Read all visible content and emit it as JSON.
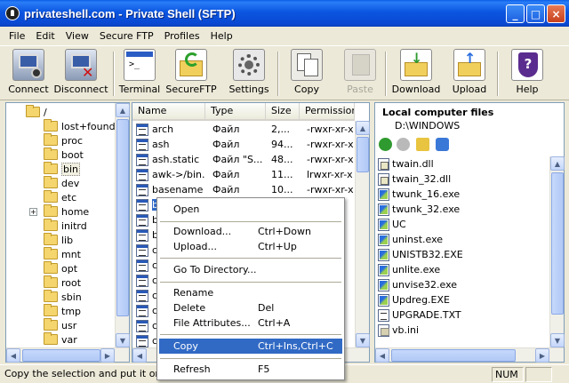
{
  "window": {
    "title": "privateshell.com - Private Shell (SFTP)",
    "min": "_",
    "max": "□",
    "close": "×"
  },
  "menu": [
    "File",
    "Edit",
    "View",
    "Secure FTP",
    "Profiles",
    "Help"
  ],
  "toolbar": {
    "connect": "Connect",
    "disconnect": "Disconnect",
    "terminal": "Terminal",
    "secureftp": "SecureFTP",
    "settings": "Settings",
    "copy": "Copy",
    "paste": "Paste",
    "download": "Download",
    "upload": "Upload",
    "help": "Help"
  },
  "tree": {
    "root": "/",
    "folders": [
      "lost+found",
      "proc",
      "boot",
      "bin",
      "dev",
      "etc",
      "home",
      "initrd",
      "lib",
      "mnt",
      "opt",
      "root",
      "sbin",
      "tmp",
      "usr",
      "var"
    ],
    "selected": "bin",
    "expander": "+"
  },
  "files": {
    "columns": [
      "Name",
      "Type",
      "Size",
      "Permissions"
    ],
    "rows": [
      {
        "name": "arch",
        "type": "Файл",
        "size": "2,...",
        "perm": "-rwxr-xr-x"
      },
      {
        "name": "ash",
        "type": "Файл",
        "size": "94...",
        "perm": "-rwxr-xr-x"
      },
      {
        "name": "ash.static",
        "type": "Файл \"S...",
        "size": "48...",
        "perm": "-rwxr-xr-x"
      },
      {
        "name": "awk->/bin...",
        "type": "Файл",
        "size": "11...",
        "perm": "lrwxr-xr-x"
      },
      {
        "name": "basename",
        "type": "Файл",
        "size": "10...",
        "perm": "-rwxr-xr-x"
      },
      {
        "name": "b",
        "type": "",
        "size": "",
        "perm": ""
      },
      {
        "name": "b",
        "type": "",
        "size": "",
        "perm": ""
      },
      {
        "name": "b",
        "type": "",
        "size": "",
        "perm": ""
      },
      {
        "name": "c",
        "type": "",
        "size": "",
        "perm": ""
      },
      {
        "name": "c",
        "type": "",
        "size": "",
        "perm": ""
      },
      {
        "name": "c",
        "type": "",
        "size": "",
        "perm": ""
      },
      {
        "name": "c",
        "type": "",
        "size": "",
        "perm": ""
      },
      {
        "name": "c",
        "type": "",
        "size": "",
        "perm": ""
      },
      {
        "name": "c",
        "type": "",
        "size": "",
        "perm": ""
      },
      {
        "name": "c",
        "type": "",
        "size": "",
        "perm": ""
      }
    ]
  },
  "context_menu": {
    "open": "Open",
    "download": {
      "label": "Download...",
      "key": "Ctrl+Down"
    },
    "upload": {
      "label": "Upload...",
      "key": "Ctrl+Up"
    },
    "goto": "Go To Directory...",
    "rename": "Rename",
    "delete": {
      "label": "Delete",
      "key": "Del"
    },
    "attributes": {
      "label": "File Attributes...",
      "key": "Ctrl+A"
    },
    "copy": {
      "label": "Copy",
      "key": "Ctrl+Ins,Ctrl+C"
    },
    "refresh": {
      "label": "Refresh",
      "key": "F5"
    }
  },
  "local": {
    "title": "Local computer files",
    "path": "D:\\WINDOWS",
    "files": [
      {
        "name": "twain.dll",
        "kind": "dll"
      },
      {
        "name": "twain_32.dll",
        "kind": "dll"
      },
      {
        "name": "twunk_16.exe",
        "kind": "exe"
      },
      {
        "name": "twunk_32.exe",
        "kind": "exe"
      },
      {
        "name": "UC",
        "kind": "exe"
      },
      {
        "name": "uninst.exe",
        "kind": "exe"
      },
      {
        "name": "UNISTB32.EXE",
        "kind": "exe"
      },
      {
        "name": "unlite.exe",
        "kind": "exe"
      },
      {
        "name": "unvise32.exe",
        "kind": "exe"
      },
      {
        "name": "Updreg.EXE",
        "kind": "exe"
      },
      {
        "name": "UPGRADE.TXT",
        "kind": "txt"
      },
      {
        "name": "vb.ini",
        "kind": "ini"
      }
    ]
  },
  "status": {
    "text": "Copy the selection and put it on the",
    "num": "NUM"
  },
  "scroll": {
    "up": "▲",
    "down": "▼",
    "left": "◀",
    "right": "▶"
  }
}
